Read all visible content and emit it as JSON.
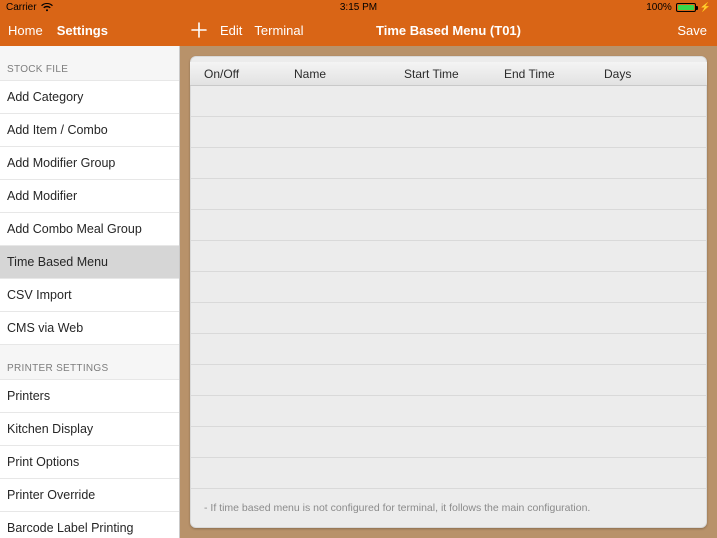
{
  "status": {
    "carrier": "Carrier",
    "time": "3:15 PM",
    "battery_pct": "100%"
  },
  "nav": {
    "home": "Home",
    "settings": "Settings",
    "edit": "Edit",
    "terminal": "Terminal",
    "title": "Time Based Menu (T01)",
    "save": "Save"
  },
  "sidebar": {
    "sections": [
      {
        "header": "STOCK FILE",
        "items": [
          {
            "label": "Add Category",
            "selected": false
          },
          {
            "label": "Add Item / Combo",
            "selected": false
          },
          {
            "label": "Add Modifier Group",
            "selected": false
          },
          {
            "label": "Add Modifier",
            "selected": false
          },
          {
            "label": "Add Combo Meal Group",
            "selected": false
          },
          {
            "label": "Time Based Menu",
            "selected": true
          },
          {
            "label": "CSV Import",
            "selected": false
          },
          {
            "label": "CMS via Web",
            "selected": false
          }
        ]
      },
      {
        "header": "PRINTER SETTINGS",
        "items": [
          {
            "label": "Printers",
            "selected": false
          },
          {
            "label": "Kitchen Display",
            "selected": false
          },
          {
            "label": "Print Options",
            "selected": false
          },
          {
            "label": "Printer Override",
            "selected": false
          },
          {
            "label": "Barcode Label Printing",
            "selected": false
          }
        ]
      }
    ]
  },
  "table": {
    "columns": {
      "onoff": "On/Off",
      "name": "Name",
      "start": "Start Time",
      "end": "End Time",
      "days": "Days"
    }
  },
  "footer": {
    "note": "- If time based menu is not configured for terminal, it follows the main configuration."
  }
}
